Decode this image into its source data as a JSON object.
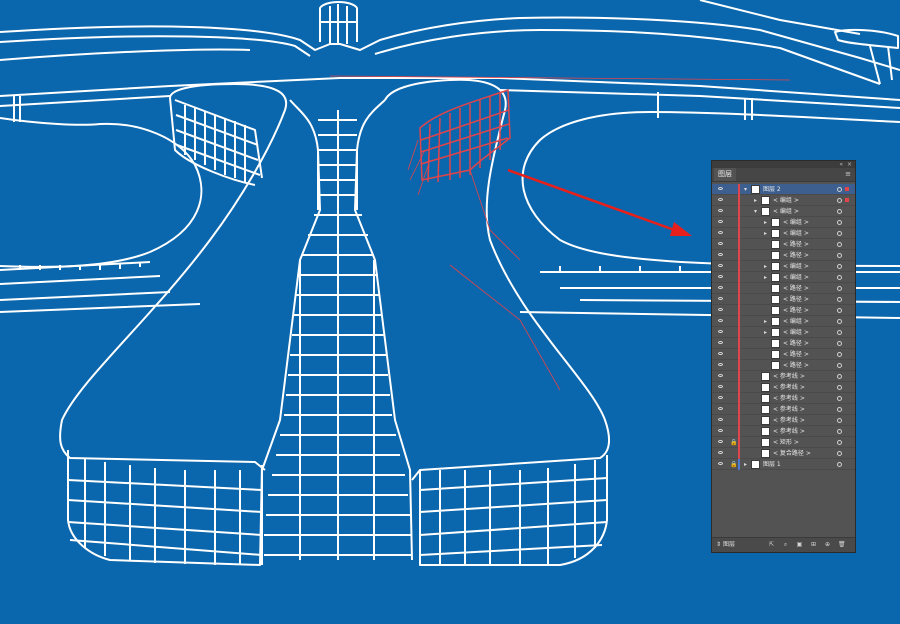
{
  "colors": {
    "background": "#0a66ad",
    "drawing_lines": "#ffffff",
    "selection": "#e0454b",
    "annotation_arrow": "#e8201b"
  },
  "layers_panel": {
    "title": "图层",
    "footer_label": "图层",
    "rows": [
      {
        "name": "图层 2",
        "indent": 0,
        "arrow": "down",
        "selected": true,
        "selbox": true,
        "lock": false,
        "bar": "red"
      },
      {
        "name": "< 编组 >",
        "indent": 1,
        "arrow": "right",
        "selected": false,
        "selbox": true,
        "lock": false,
        "bar": "red"
      },
      {
        "name": "< 编组 >",
        "indent": 1,
        "arrow": "down",
        "selected": false,
        "selbox": false,
        "lock": false,
        "bar": "red"
      },
      {
        "name": "< 编组 >",
        "indent": 2,
        "arrow": "right",
        "selected": false,
        "selbox": false,
        "lock": false,
        "bar": "red"
      },
      {
        "name": "< 编组 >",
        "indent": 2,
        "arrow": "right",
        "selected": false,
        "selbox": false,
        "lock": false,
        "bar": "red"
      },
      {
        "name": "< 路径 >",
        "indent": 2,
        "arrow": "",
        "selected": false,
        "selbox": false,
        "lock": false,
        "bar": "red"
      },
      {
        "name": "< 路径 >",
        "indent": 2,
        "arrow": "",
        "selected": false,
        "selbox": false,
        "lock": false,
        "bar": "red"
      },
      {
        "name": "< 编组 >",
        "indent": 2,
        "arrow": "right",
        "selected": false,
        "selbox": false,
        "lock": false,
        "bar": "red"
      },
      {
        "name": "< 编组 >",
        "indent": 2,
        "arrow": "right",
        "selected": false,
        "selbox": false,
        "lock": false,
        "bar": "red"
      },
      {
        "name": "< 路径 >",
        "indent": 2,
        "arrow": "",
        "selected": false,
        "selbox": false,
        "lock": false,
        "bar": "red"
      },
      {
        "name": "< 路径 >",
        "indent": 2,
        "arrow": "",
        "selected": false,
        "selbox": false,
        "lock": false,
        "bar": "red"
      },
      {
        "name": "< 路径 >",
        "indent": 2,
        "arrow": "",
        "selected": false,
        "selbox": false,
        "lock": false,
        "bar": "red"
      },
      {
        "name": "< 编组 >",
        "indent": 2,
        "arrow": "right",
        "selected": false,
        "selbox": false,
        "lock": false,
        "bar": "red"
      },
      {
        "name": "< 编组 >",
        "indent": 2,
        "arrow": "right",
        "selected": false,
        "selbox": false,
        "lock": false,
        "bar": "red"
      },
      {
        "name": "< 路径 >",
        "indent": 2,
        "arrow": "",
        "selected": false,
        "selbox": false,
        "lock": false,
        "bar": "red"
      },
      {
        "name": "< 路径 >",
        "indent": 2,
        "arrow": "",
        "selected": false,
        "selbox": false,
        "lock": false,
        "bar": "red"
      },
      {
        "name": "< 路径 >",
        "indent": 2,
        "arrow": "",
        "selected": false,
        "selbox": false,
        "lock": false,
        "bar": "red"
      },
      {
        "name": "< 参考线 >",
        "indent": 1,
        "arrow": "",
        "selected": false,
        "selbox": false,
        "lock": false,
        "bar": "red"
      },
      {
        "name": "< 参考线 >",
        "indent": 1,
        "arrow": "",
        "selected": false,
        "selbox": false,
        "lock": false,
        "bar": "red"
      },
      {
        "name": "< 参考线 >",
        "indent": 1,
        "arrow": "",
        "selected": false,
        "selbox": false,
        "lock": false,
        "bar": "red"
      },
      {
        "name": "< 参考线 >",
        "indent": 1,
        "arrow": "",
        "selected": false,
        "selbox": false,
        "lock": false,
        "bar": "red"
      },
      {
        "name": "< 参考线 >",
        "indent": 1,
        "arrow": "",
        "selected": false,
        "selbox": false,
        "lock": false,
        "bar": "red"
      },
      {
        "name": "< 参考线 >",
        "indent": 1,
        "arrow": "",
        "selected": false,
        "selbox": false,
        "lock": false,
        "bar": "red"
      },
      {
        "name": "< 矩形 >",
        "indent": 1,
        "arrow": "",
        "selected": false,
        "selbox": false,
        "lock": true,
        "bar": "red"
      },
      {
        "name": "< 复合路径 >",
        "indent": 1,
        "arrow": "",
        "selected": false,
        "selbox": false,
        "lock": false,
        "bar": "red"
      },
      {
        "name": "图层 1",
        "indent": 0,
        "arrow": "right",
        "selected": false,
        "selbox": false,
        "lock": true,
        "bar": "blue"
      }
    ]
  }
}
